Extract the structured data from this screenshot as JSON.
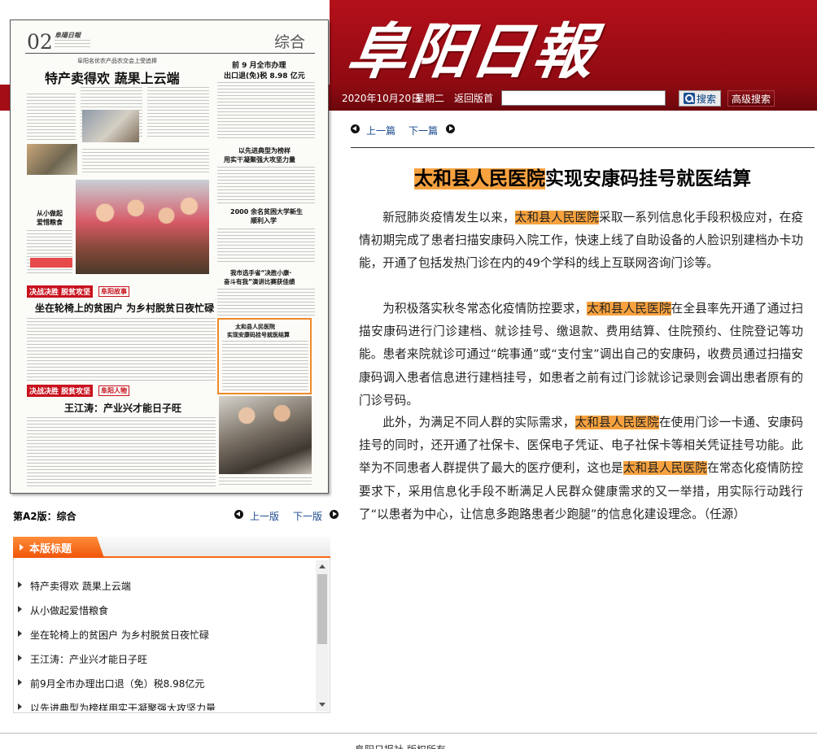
{
  "header": {
    "logo_text": "阜阳日報",
    "date": "2020年10月20日",
    "weekday": "星期二",
    "back_link": "返回版首",
    "search_value": "",
    "search_button": "搜索",
    "advanced_search_button": "高级搜索"
  },
  "page_thumb": {
    "page_number": "02",
    "masthead": "阜陽日報",
    "section": "综合",
    "kicker_1": "阜阳名优农产品农交会上受追捧",
    "headline_1": "特产卖得欢  蔬果上云端",
    "headline_2a": "前 9 月全市办理",
    "headline_2b": "出口退(免)税 8.98 亿元",
    "headline_3a": "以先进典型为榜样",
    "headline_3b": "用实干凝聚强大攻坚力量",
    "headline_4a": "2000 余名贫困大学新生",
    "headline_4b": "顺利入学",
    "headline_5a": "我市选手省“决胜小康·",
    "headline_5b": "奋斗有我”演讲比赛获佳绩",
    "side_head_a": "从小做起",
    "side_head_b": "爱惜粮食",
    "red_label_1": "决战决胜 脱贫攻坚",
    "red_label_1b": "阜阳故事",
    "headline_6": "坐在轮椅上的贫困户 为乡村脱贫日夜忙碌",
    "box_title_a": "太和县人民医院",
    "box_title_b": "实现安康码挂号就医结算",
    "red_label_2": "决战决胜 脱贫攻坚",
    "red_label_2b": "阜阳人物",
    "headline_7": "王江涛：产业兴才能日子旺"
  },
  "page_nav": {
    "page_label": "第A2版：综合",
    "prev": "上一版",
    "next": "下一版"
  },
  "headlines_box": {
    "title": "本版标题",
    "items": [
      "特产卖得欢 蔬果上云端",
      "从小做起爱惜粮食",
      "坐在轮椅上的贫困户 为乡村脱贫日夜忙碌",
      "王江涛：产业兴才能日子旺",
      "前9月全市办理出口退（免）税8.98亿元",
      "以先进典型为榜样用实干凝聚强大攻坚力量"
    ]
  },
  "article": {
    "prev": "上一篇",
    "next": "下一篇",
    "highlight": "太和县人民医院",
    "title_rest": "实现安康码挂号就医结算",
    "p1_a": "新冠肺炎疫情发生以来，",
    "p1_b": "采取一系列信息化手段积极应对，在疫情初期完成了患者扫描安康码入院工作，快速上线了自助设备的人脸识别建档办卡功能，开通了包括发热门诊在内的49个学科的线上互联网咨询门诊等。",
    "p2_a": "为积极落实秋冬常态化疫情防控要求，",
    "p2_b": "在全县率先开通了通过扫描安康码进行门诊建档、就诊挂号、缴退款、费用结算、住院预约、住院登记等功能。患者来院就诊可通过“皖事通”或“支付宝”调出自己的安康码，收费员通过扫描安康码调入患者信息进行建档挂号，如患者之前有过门诊就诊记录则会调出患者原有的门诊号码。",
    "p3_a": "此外，为满足不同人群的实际需求，",
    "p3_b": "在使用门诊一卡通、安康码挂号的同时，还开通了社保卡、医保电子凭证、电子社保卡等相关凭证挂号功能。此举为不同患者人群提供了最大的医疗便利，这也是",
    "p3_c": "在常态化疫情防控要求下，采用信息化手段不断满足人民群众健康需求的又一举措，用实际行动践行了“以患者为中心，让信息多跑路患者少跑腿”的信息化建设理念。（任源）"
  },
  "footer": {
    "text": "阜阳日报社  版权所有"
  },
  "colors": {
    "header_red": "#b4101a",
    "highlight": "#f7a23f",
    "tab_orange": "#f26a12",
    "link_blue": "#1b4b8e"
  }
}
